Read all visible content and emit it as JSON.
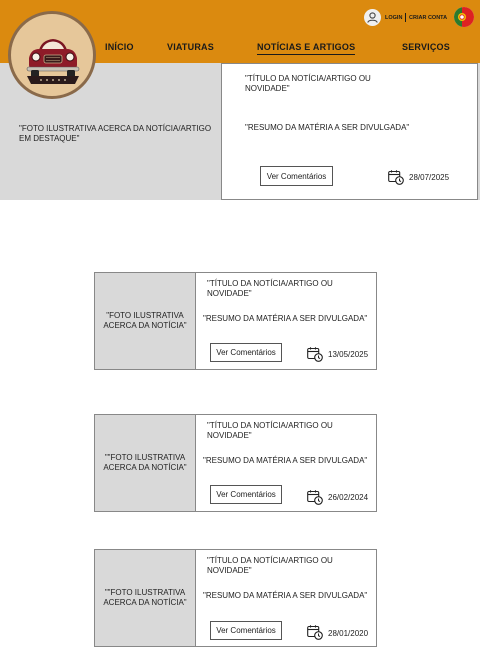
{
  "header": {
    "nav": [
      "INÍCIO",
      "VIATURAS",
      "NOTÍCIAS E ARTIGOS",
      "SERVIÇOS"
    ],
    "active_nav": "NOTÍCIAS E ARTIGOS",
    "login": "LOGIN",
    "create_account": "CRIAR CONTA",
    "icons": {
      "logo": "classic-car-logo",
      "user": "user-icon",
      "language": "flag-icon"
    },
    "colors": {
      "bar": "#db8a0f",
      "hero_bg": "#d9d9d9"
    }
  },
  "featured": {
    "photo": "\"FOTO ILUSTRATIVA ACERCA DA NOTÍCIA/ARTIGO EM DESTAQUE\"",
    "title": "\"TÍTULO DA NOTÍCIA/ARTIGO OU NOVIDADE\"",
    "summary": "\"RESUMO DA MATÉRIA A SER DIVULGADA\"",
    "button": "Ver Comentários",
    "date": "28/07/2025"
  },
  "articles": [
    {
      "photo": "\"FOTO ILUSTRATIVA ACERCA DA NOTÍCIA\"",
      "title": "\"TÍTULO DA NOTÍCIA/ARTIGO OU NOVIDADE\"",
      "summary": "\"RESUMO DA MATÉRIA A SER DIVULGADA\"",
      "button": "Ver Comentários",
      "date": "13/05/2025"
    },
    {
      "photo": "\"\"FOTO ILUSTRATIVA ACERCA DA NOTÍCIA\"",
      "title": "\"TÍTULO DA NOTÍCIA/ARTIGO OU NOVIDADE\"",
      "summary": "\"RESUMO DA MATÉRIA A SER DIVULGADA\"",
      "button": "Ver Comentários",
      "date": "26/02/2024"
    },
    {
      "photo": "\"\"FOTO ILUSTRATIVA ACERCA DA NOTÍCIA\"",
      "title": "\"TÍTULO DA NOTÍCIA/ARTIGO OU NOVIDADE\"",
      "summary": "\"RESUMO DA MATÉRIA A SER DIVULGADA\"",
      "button": "Ver Comentários",
      "date": "28/01/2020"
    }
  ]
}
